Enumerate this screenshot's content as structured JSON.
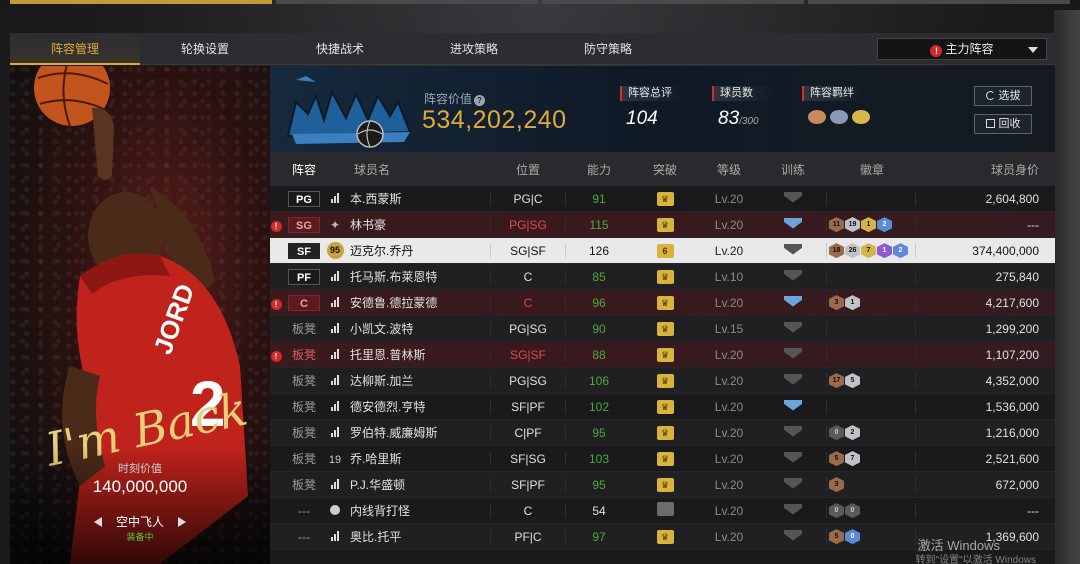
{
  "nav": {
    "tabs": [
      "阵容管理",
      "轮换设置",
      "快捷战术",
      "进攻策略",
      "防守策略"
    ],
    "active": 0,
    "lineup_select": "主力阵容"
  },
  "player_card": {
    "signature": "I'm Back",
    "jersey_text": "JORD",
    "jersey_number": "2",
    "moment_label": "时刻价值",
    "moment_value": "140,000,000",
    "skill_name": "空中飞人",
    "equipped": "装备中"
  },
  "team": {
    "valuation_label": "阵容价值",
    "valuation": "534,202,240",
    "rating_label": "阵容总评",
    "rating": "104",
    "players_label": "球员数",
    "players": "83",
    "players_max": "/300",
    "chem_label": "阵容羁绊",
    "btn_select": "选拔",
    "btn_recycle": "回收",
    "chem_colors": [
      "#c78a5a",
      "#8a98b8",
      "#d9b84a"
    ]
  },
  "table": {
    "headers": [
      "阵容",
      "球员名",
      "位置",
      "能力",
      "突破",
      "等级",
      "训练",
      "徽章",
      "球员身价"
    ],
    "rows": [
      {
        "role": "PG",
        "boxed": true,
        "warn": false,
        "state": "normal",
        "icon": "bars",
        "name": "本.西蒙斯",
        "pos": "PG|C",
        "pos_red": false,
        "ability": "91",
        "ability_color": "green",
        "break": "crown",
        "level": "Lv.20",
        "train": "grey",
        "badges": [],
        "worth": "2,604,800"
      },
      {
        "role": "SG",
        "boxed": true,
        "warn": true,
        "state": "red",
        "icon": "star",
        "name": "林书豪",
        "pos": "PG|SG",
        "pos_red": true,
        "ability": "115",
        "ability_color": "green",
        "break": "crown",
        "level": "Lv.20",
        "train": "blue",
        "badges": [
          [
            "brown",
            "11"
          ],
          [
            "silver",
            "19"
          ],
          [
            "gold",
            "1"
          ],
          [
            "blue",
            "2"
          ]
        ],
        "worth": "---"
      },
      {
        "role": "SF",
        "boxed": true,
        "warn": false,
        "state": "sel",
        "icon": "ovr",
        "icon_text": "95",
        "name": "迈克尔.乔丹",
        "pos": "SG|SF",
        "pos_red": false,
        "ability": "126",
        "ability_color": "dark",
        "break": "6",
        "level": "Lv.20",
        "train": "grey",
        "badges": [
          [
            "brown",
            "18"
          ],
          [
            "silver",
            "26"
          ],
          [
            "gold",
            "7"
          ],
          [
            "purple",
            "1"
          ],
          [
            "blue",
            "2"
          ]
        ],
        "worth": "374,400,000"
      },
      {
        "role": "PF",
        "boxed": true,
        "warn": false,
        "state": "normal",
        "icon": "bars",
        "name": "托马斯.布莱恩特",
        "pos": "C",
        "pos_red": false,
        "ability": "85",
        "ability_color": "green",
        "break": "crown",
        "level": "Lv.10",
        "train": "grey",
        "badges": [],
        "worth": "275,840"
      },
      {
        "role": "C",
        "boxed": true,
        "warn": true,
        "state": "red",
        "icon": "bars",
        "name": "安德鲁.德拉蒙德",
        "pos": "C",
        "pos_red": true,
        "ability": "96",
        "ability_color": "green",
        "break": "crown",
        "level": "Lv.20",
        "train": "blue",
        "badges": [
          [
            "brown",
            "3"
          ],
          [
            "silver",
            "1"
          ]
        ],
        "worth": "4,217,600"
      },
      {
        "role": "板凳",
        "boxed": false,
        "warn": false,
        "state": "normal",
        "icon": "bars",
        "name": "小凯文.波特",
        "pos": "PG|SG",
        "pos_red": false,
        "ability": "90",
        "ability_color": "green",
        "break": "crown",
        "level": "Lv.15",
        "train": "grey",
        "badges": [],
        "worth": "1,299,200"
      },
      {
        "role": "板凳",
        "boxed": false,
        "warn": true,
        "state": "red",
        "icon": "bars",
        "name": "托里恩.普林斯",
        "pos": "SG|SF",
        "pos_red": true,
        "ability": "88",
        "ability_color": "green",
        "break": "crown",
        "level": "Lv.20",
        "train": "grey",
        "badges": [],
        "worth": "1,107,200"
      },
      {
        "role": "板凳",
        "boxed": false,
        "warn": false,
        "state": "normal",
        "icon": "bars",
        "name": "达柳斯.加兰",
        "pos": "PG|SG",
        "pos_red": false,
        "ability": "106",
        "ability_color": "green",
        "break": "crown",
        "level": "Lv.20",
        "train": "grey",
        "badges": [
          [
            "brown",
            "17"
          ],
          [
            "silver",
            "5"
          ]
        ],
        "worth": "4,352,000"
      },
      {
        "role": "板凳",
        "boxed": false,
        "warn": false,
        "state": "normal",
        "icon": "bars",
        "name": "德安德烈.亨特",
        "pos": "SF|PF",
        "pos_red": false,
        "ability": "102",
        "ability_color": "green",
        "break": "crown",
        "level": "Lv.20",
        "train": "blue",
        "badges": [],
        "worth": "1,536,000"
      },
      {
        "role": "板凳",
        "boxed": false,
        "warn": false,
        "state": "normal",
        "icon": "bars",
        "name": "罗伯特.威廉姆斯",
        "pos": "C|PF",
        "pos_red": false,
        "ability": "95",
        "ability_color": "green",
        "break": "crown",
        "level": "Lv.20",
        "train": "grey",
        "badges": [
          [
            "dark",
            "0"
          ],
          [
            "silver",
            "2"
          ]
        ],
        "worth": "1,216,000"
      },
      {
        "role": "板凳",
        "boxed": false,
        "warn": false,
        "state": "normal",
        "icon": "num",
        "icon_text": "19",
        "name": "乔.哈里斯",
        "pos": "SF|SG",
        "pos_red": false,
        "ability": "103",
        "ability_color": "green",
        "break": "crown",
        "level": "Lv.20",
        "train": "grey",
        "badges": [
          [
            "brown",
            "5"
          ],
          [
            "silver",
            "7"
          ]
        ],
        "worth": "2,521,600"
      },
      {
        "role": "板凳",
        "boxed": false,
        "warn": false,
        "state": "normal",
        "icon": "bars",
        "name": "P.J.华盛顿",
        "pos": "SF|PF",
        "pos_red": false,
        "ability": "95",
        "ability_color": "green",
        "break": "crown",
        "level": "Lv.20",
        "train": "grey",
        "badges": [
          [
            "brown",
            "3"
          ]
        ],
        "worth": "672,000"
      },
      {
        "role": "---",
        "boxed": false,
        "warn": false,
        "state": "normal",
        "icon": "avatar",
        "name": "内线背打怪",
        "pos": "C",
        "pos_red": false,
        "ability": "54",
        "ability_color": "white",
        "break": "dim",
        "level": "Lv.20",
        "train": "grey",
        "badges": [
          [
            "dark",
            "0"
          ],
          [
            "dark",
            "0"
          ]
        ],
        "worth": "---"
      },
      {
        "role": "---",
        "boxed": false,
        "warn": false,
        "state": "normal",
        "icon": "bars",
        "name": "奥比.托平",
        "pos": "PF|C",
        "pos_red": false,
        "ability": "97",
        "ability_color": "green",
        "break": "crown",
        "level": "Lv.20",
        "train": "grey",
        "badges": [
          [
            "brown",
            "5"
          ],
          [
            "blue",
            "0"
          ]
        ],
        "worth": "1,369,600"
      }
    ]
  },
  "watermark": {
    "title": "激活 Windows",
    "sub": "转到\"设置\"以激活 Windows"
  }
}
